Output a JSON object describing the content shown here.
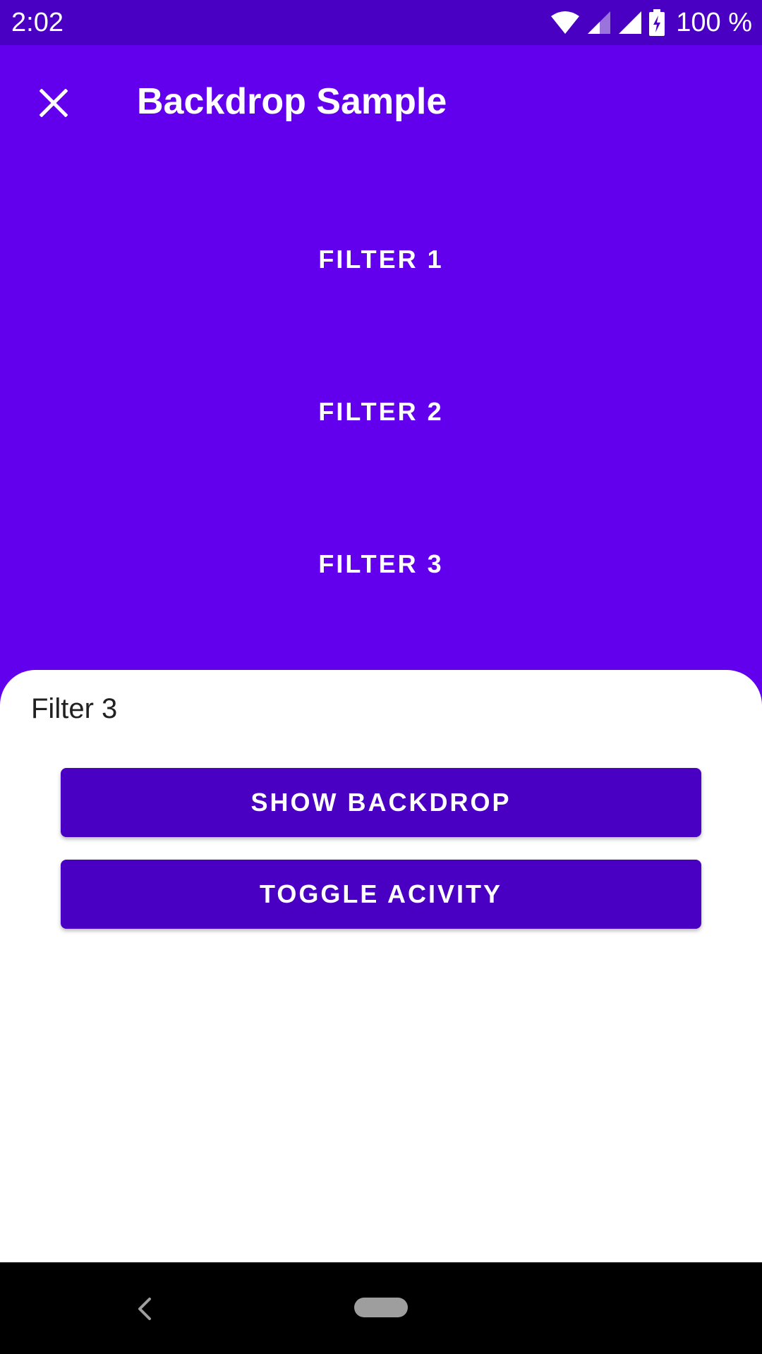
{
  "status_bar": {
    "time": "2:02",
    "battery_text": "100 %",
    "icons": [
      "wifi-icon",
      "cell-signal-icon",
      "cell-signal-icon",
      "battery-charging-icon"
    ]
  },
  "app_bar": {
    "title": "Backdrop Sample",
    "nav_icon": "close-icon"
  },
  "backdrop": {
    "filters": [
      {
        "label": "FILTER 1"
      },
      {
        "label": "FILTER 2"
      },
      {
        "label": "FILTER 3"
      }
    ]
  },
  "front_layer": {
    "subtitle": "Filter 3",
    "show_backdrop_label": "SHOW BACKDROP",
    "toggle_activity_label": "TOGGLE ACIVITY"
  },
  "nav_bar": {
    "icons": [
      "back-icon",
      "home-pill-icon"
    ]
  },
  "colors": {
    "primary": "#6200EE",
    "primary_dark": "#4A00C2",
    "surface": "#FFFFFF",
    "on_primary": "#FFFFFF"
  }
}
